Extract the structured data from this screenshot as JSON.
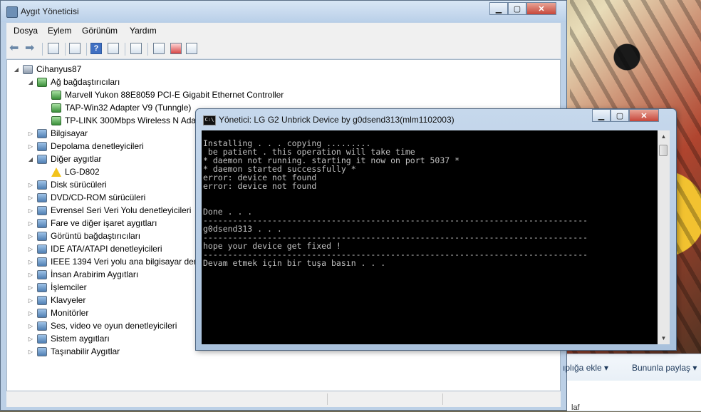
{
  "device_manager": {
    "title": "Aygıt Yöneticisi",
    "menu": [
      "Dosya",
      "Eylem",
      "Görünüm",
      "Yardım"
    ],
    "window_buttons": {
      "minimize": "▁",
      "maximize": "▢",
      "close": "✕"
    },
    "tree": {
      "root": "Cihanyus87",
      "items": [
        {
          "label": "Ağ bağdaştırıcıları",
          "icon": "network-adapter-icon",
          "expanded": true
        },
        {
          "label": "Marvell Yukon 88E8059 PCI-E Gigabit Ethernet Controller",
          "icon": "network-adapter-icon",
          "child": true
        },
        {
          "label": "TAP-Win32 Adapter V9 (Tunngle)",
          "icon": "network-adapter-icon",
          "child": true
        },
        {
          "label": "TP-LINK 300Mbps Wireless N Adap",
          "icon": "network-adapter-icon",
          "child": true
        },
        {
          "label": "Bilgisayar",
          "icon": "computer-icon"
        },
        {
          "label": "Depolama denetleyicileri",
          "icon": "storage-icon"
        },
        {
          "label": "Diğer aygıtlar",
          "icon": "other-devices-icon",
          "expanded": true
        },
        {
          "label": "LG-D802",
          "icon": "warning-icon",
          "child": true
        },
        {
          "label": "Disk sürücüleri",
          "icon": "disk-icon"
        },
        {
          "label": "DVD/CD-ROM sürücüleri",
          "icon": "dvd-icon"
        },
        {
          "label": "Evrensel Seri Veri Yolu denetleyicileri",
          "icon": "usb-icon"
        },
        {
          "label": "Fare ve diğer işaret aygıtları",
          "icon": "mouse-icon"
        },
        {
          "label": "Görüntü bağdaştırıcıları",
          "icon": "display-adapter-icon"
        },
        {
          "label": "IDE ATA/ATAPI denetleyicileri",
          "icon": "ide-icon"
        },
        {
          "label": "IEEE 1394 Veri yolu ana bilgisayar denet",
          "icon": "ieee1394-icon"
        },
        {
          "label": "İnsan Arabirim Aygıtları",
          "icon": "hid-icon"
        },
        {
          "label": "İşlemciler",
          "icon": "processor-icon"
        },
        {
          "label": "Klavyeler",
          "icon": "keyboard-icon"
        },
        {
          "label": "Monitörler",
          "icon": "monitor-icon"
        },
        {
          "label": "Ses, video ve oyun denetleyicileri",
          "icon": "sound-icon"
        },
        {
          "label": "Sistem aygıtları",
          "icon": "system-icon"
        },
        {
          "label": "Taşınabilir Aygıtlar",
          "icon": "portable-device-icon"
        }
      ]
    }
  },
  "console": {
    "title": "Yönetici:  LG G2 Unbrick Device by g0dsend313(mlm1102003)",
    "icon_text": "C:\\",
    "window_buttons": {
      "minimize": "▁",
      "maximize": "▢",
      "close": "✕"
    },
    "output": "Installing . . . copying .........\n be patient . this operation will take time\n* daemon not running. starting it now on port 5037 *\n* daemon started successfully *\nerror: device not found\nerror: device not found\n\n\nDone . . .\n------------------------------------------------------------------------------\ng0dsend313 . . .\n------------------------------------------------------------------------------\nhope your device get fixed !\n------------------------------------------------------------------------------\nDevam etmek için bir tuşa basın . . ."
  },
  "explorer": {
    "buttons": [
      {
        "label": "ıplığa ekle ▾"
      },
      {
        "label": "Bununla paylaş ▾"
      }
    ],
    "fragment_text": "laf"
  }
}
